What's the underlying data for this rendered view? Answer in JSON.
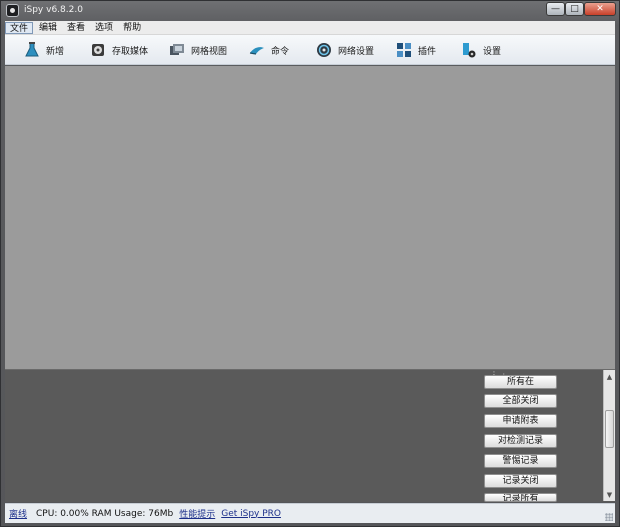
{
  "window": {
    "title": "iSpy v6.8.2.0",
    "min_glyph": "—",
    "max_glyph": "□",
    "close_glyph": "✕"
  },
  "menubar": {
    "items": [
      "文件",
      "编辑",
      "查看",
      "选项",
      "帮助"
    ],
    "active_index": 0
  },
  "toolbar": {
    "items": [
      {
        "label": "新增",
        "icon": "add-flask-icon"
      },
      {
        "label": "存取媒体",
        "icon": "media-disk-icon"
      },
      {
        "label": "网格视图",
        "icon": "grid-view-icon"
      },
      {
        "label": "命令",
        "icon": "command-icon"
      },
      {
        "label": "网络设置",
        "icon": "network-settings-icon"
      },
      {
        "label": "插件",
        "icon": "plugins-icon"
      },
      {
        "label": "设置",
        "icon": "settings-icon"
      }
    ]
  },
  "action_panel": {
    "dots": "⋮ ·",
    "buttons": [
      "所有在",
      "全部关闭",
      "申请附表",
      "对检测记录",
      "警惕记录",
      "记录关闭",
      "记录所有"
    ]
  },
  "statusbar": {
    "offline": "离线",
    "cpu_ram": "CPU: 0.00% RAM Usage: 76Mb",
    "tips": "性能提示",
    "pro": "Get iSpy PRO"
  },
  "colors": {
    "main_area": "#9b9b9b",
    "panel": "#5a5a5a",
    "link": "#1c2f8a"
  }
}
